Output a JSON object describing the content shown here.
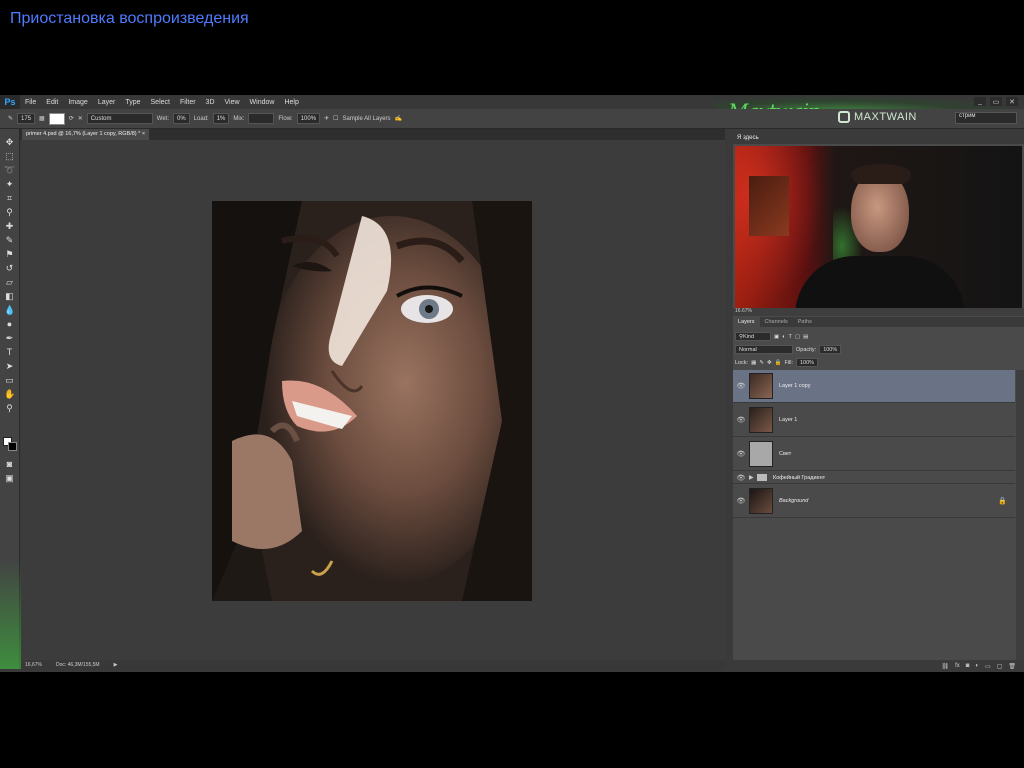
{
  "overlay": {
    "paused_text": "Приостановка воспроизведения"
  },
  "menubar": {
    "logo": "Ps",
    "items": [
      "File",
      "Edit",
      "Image",
      "Layer",
      "Type",
      "Select",
      "Filter",
      "3D",
      "View",
      "Window",
      "Help"
    ],
    "window_controls": [
      "_",
      "▭",
      "✕"
    ]
  },
  "optionsbar": {
    "brush_size": "175",
    "preset": "Custom",
    "wet_label": "Wet:",
    "wet_value": "0%",
    "load_label": "Load:",
    "load_value": "1%",
    "mix_label": "Mix:",
    "flow_label": "Flow:",
    "flow_value": "100%",
    "sample_all": "Sample All Layers",
    "workspace": "стрим"
  },
  "branding": {
    "instagram_handle": "MAXTWAIN",
    "signature": "Maxtwain"
  },
  "document": {
    "tab_title": "primer 4.psd @ 16,7% (Layer 1 copy, RGB/8) *",
    "tab_close": "×"
  },
  "statusbar": {
    "zoom": "16,67%",
    "doc_info": "Doc: 46,3M/155,5M"
  },
  "right_panel": {
    "webcam_title": "Я здесь",
    "nav_zoom": "16.67%",
    "tabs": [
      "Layers",
      "Channels",
      "Paths"
    ],
    "kind_label": "Kind",
    "blend_mode": "Normal",
    "opacity_label": "Opacity:",
    "opacity_value": "100%",
    "lock_label": "Lock:",
    "fill_label": "Fill:",
    "fill_value": "100%",
    "layers": [
      {
        "name": "Layer 1 copy",
        "selected": true
      },
      {
        "name": "Layer 1",
        "selected": false
      },
      {
        "name": "Свет",
        "selected": false
      },
      {
        "name": "Кофейный Градиент",
        "selected": false,
        "group": true
      },
      {
        "name": "Background",
        "selected": false,
        "locked": true
      }
    ],
    "footer_icons": [
      "link-icon",
      "fx-icon",
      "mask-icon",
      "adjustment-icon",
      "folder-icon",
      "new-layer-icon",
      "trash-icon"
    ]
  },
  "colors": {
    "accent_overlay": "#4f7bff",
    "selected_layer": "#6a7385",
    "brand_green": "#5fd65f"
  }
}
